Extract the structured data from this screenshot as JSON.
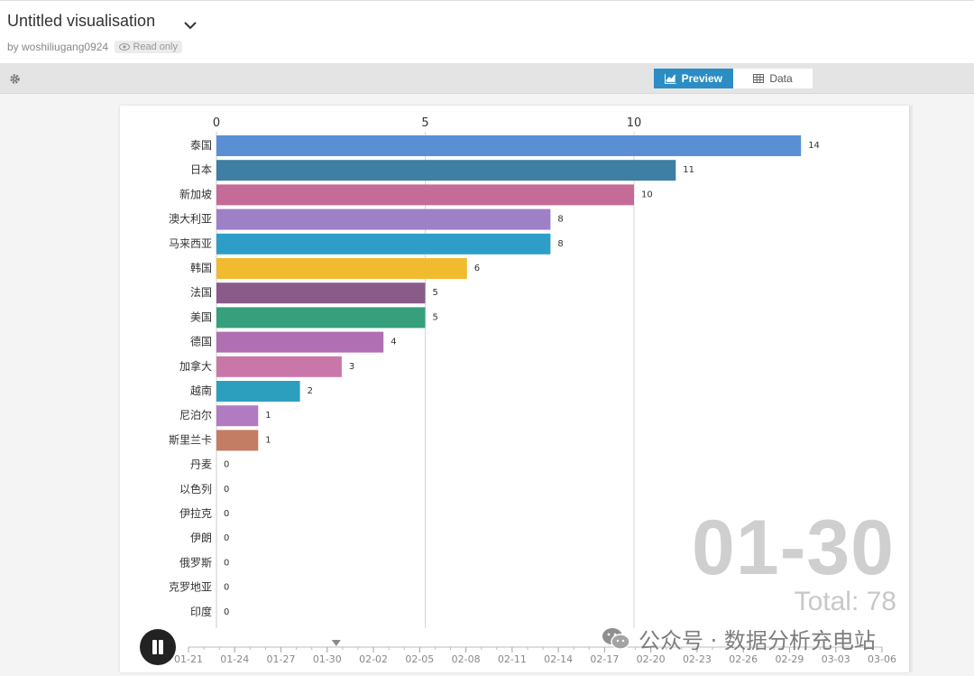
{
  "header": {
    "title": "Untitled visualisation",
    "byline": "by woshiliugang0924",
    "readonly": "Read only"
  },
  "toolbar": {
    "tabs": [
      {
        "label": "Preview",
        "active": true
      },
      {
        "label": "Data",
        "active": false
      }
    ]
  },
  "colors": {
    "accent": "#2b8dc4",
    "bars": [
      "#5b8fd4",
      "#3e7fa3",
      "#c56b98",
      "#9e80c6",
      "#2e9ec8",
      "#f1bb2f",
      "#8a5b88",
      "#36a07c",
      "#b06fb2",
      "#c977a9",
      "#2c9fbf",
      "#b07bc0",
      "#c27d64"
    ]
  },
  "chart_data": {
    "type": "bar",
    "orientation": "horizontal",
    "x_ticks": [
      "0",
      "5",
      "10"
    ],
    "xlim": [
      0,
      14
    ],
    "categories": [
      "泰国",
      "日本",
      "新加坡",
      "澳大利亚",
      "马来西亚",
      "韩国",
      "法国",
      "美国",
      "德国",
      "加拿大",
      "越南",
      "尼泊尔",
      "斯里兰卡",
      "丹麦",
      "以色列",
      "伊拉克",
      "伊朗",
      "俄罗斯",
      "克罗地亚",
      "印度"
    ],
    "values": [
      14,
      11,
      10,
      8,
      8,
      6,
      5,
      5,
      4,
      3,
      2,
      1,
      1,
      0,
      0,
      0,
      0,
      0,
      0,
      0
    ],
    "current_date": "01-30",
    "total_label": "Total: 78",
    "timeline": [
      "01-21",
      "01-24",
      "01-27",
      "01-30",
      "02-02",
      "02-05",
      "02-08",
      "02-11",
      "02-14",
      "02-17",
      "02-20",
      "02-23",
      "02-26",
      "02-29",
      "03-03",
      "03-06"
    ],
    "timeline_current_index": 3
  },
  "watermark": {
    "text": "公众号 · 数据分析充电站",
    "icon": "wechat-icon"
  }
}
